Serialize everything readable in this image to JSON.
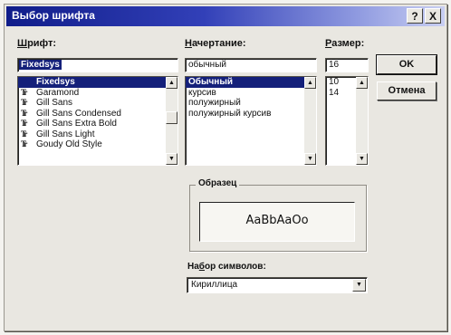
{
  "window": {
    "title": "Выбор шрифта",
    "help_label": "?",
    "close_label": "X"
  },
  "font": {
    "label_underlined": "Ш",
    "label_rest": "рифт:",
    "value": "Fixedsys",
    "items": [
      {
        "name": "Fixedsys",
        "type_icon": "",
        "selected": true
      },
      {
        "name": "Garamond",
        "type_icon": "Tr",
        "selected": false
      },
      {
        "name": "Gill Sans",
        "type_icon": "Tr",
        "selected": false
      },
      {
        "name": "Gill Sans Condensed",
        "type_icon": "Tr",
        "selected": false
      },
      {
        "name": "Gill Sans Extra Bold",
        "type_icon": "Tr",
        "selected": false
      },
      {
        "name": "Gill Sans Light",
        "type_icon": "Tr",
        "selected": false
      },
      {
        "name": "Goudy Old Style",
        "type_icon": "Tr",
        "selected": false
      }
    ]
  },
  "style": {
    "label_underlined": "Н",
    "label_rest": "ачертание:",
    "value": "обычный",
    "items": [
      {
        "name": "Обычный",
        "selected": true
      },
      {
        "name": "курсив",
        "selected": false
      },
      {
        "name": "полужирный",
        "selected": false
      },
      {
        "name": "полужирный курсив",
        "selected": false
      }
    ]
  },
  "size": {
    "label_underlined": "Р",
    "label_rest": "азмер:",
    "value": "16",
    "items": [
      {
        "name": "10",
        "selected": false
      },
      {
        "name": "14",
        "selected": false
      }
    ]
  },
  "buttons": {
    "ok": "OK",
    "cancel": "Отмена"
  },
  "sample": {
    "group_label": "Образец",
    "text": "AaBbAaOo"
  },
  "charset": {
    "label_pre": "На",
    "label_underlined": "б",
    "label_rest": "ор символов:",
    "value": "Кириллица"
  },
  "icons": {
    "scroll_up": "▲",
    "scroll_down": "▼",
    "dropdown": "▼"
  },
  "colors": {
    "title_gradient_start": "#101d8a",
    "selection": "#14207a",
    "face": "#e9e7e1"
  }
}
